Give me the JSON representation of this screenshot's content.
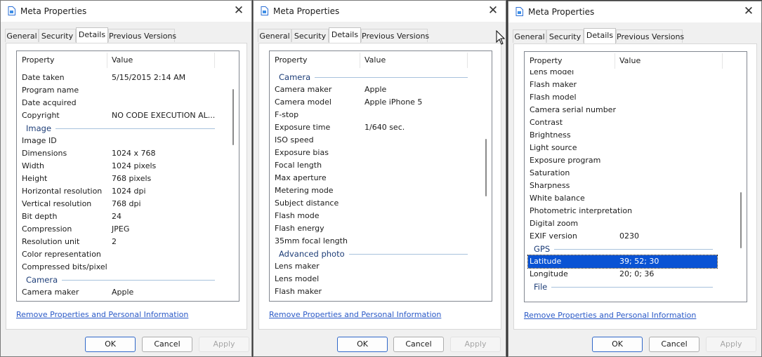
{
  "dialogs": [
    {
      "title": "Meta Properties",
      "tabs": [
        "General",
        "Security",
        "Details",
        "Previous Versions"
      ],
      "active_tab": "Details",
      "columns": {
        "property": "Property",
        "value": "Value"
      },
      "rows": [
        {
          "type": "row",
          "p": "Date taken",
          "v": "5/15/2015 2:14 AM"
        },
        {
          "type": "row",
          "p": "Program name",
          "v": ""
        },
        {
          "type": "row",
          "p": "Date acquired",
          "v": ""
        },
        {
          "type": "row",
          "p": "Copyright",
          "v": "NO CODE EXECUTION AL..."
        },
        {
          "type": "group",
          "p": "Image"
        },
        {
          "type": "row",
          "p": "Image ID",
          "v": ""
        },
        {
          "type": "row",
          "p": "Dimensions",
          "v": "1024 x 768"
        },
        {
          "type": "row",
          "p": "Width",
          "v": "1024 pixels"
        },
        {
          "type": "row",
          "p": "Height",
          "v": "768 pixels"
        },
        {
          "type": "row",
          "p": "Horizontal resolution",
          "v": "1024 dpi"
        },
        {
          "type": "row",
          "p": "Vertical resolution",
          "v": "768 dpi"
        },
        {
          "type": "row",
          "p": "Bit depth",
          "v": "24"
        },
        {
          "type": "row",
          "p": "Compression",
          "v": "JPEG"
        },
        {
          "type": "row",
          "p": "Resolution unit",
          "v": "2"
        },
        {
          "type": "row",
          "p": "Color representation",
          "v": ""
        },
        {
          "type": "row",
          "p": "Compressed bits/pixel",
          "v": ""
        },
        {
          "type": "group",
          "p": "Camera"
        },
        {
          "type": "row",
          "p": "Camera maker",
          "v": "Apple"
        }
      ],
      "remove_link": "Remove Properties and Personal Information",
      "buttons": {
        "ok": "OK",
        "cancel": "Cancel",
        "apply": "Apply"
      }
    },
    {
      "title": "Meta Properties",
      "tabs": [
        "General",
        "Security",
        "Details",
        "Previous Versions"
      ],
      "active_tab": "Details",
      "columns": {
        "property": "Property",
        "value": "Value"
      },
      "rows": [
        {
          "type": "group",
          "p": "Camera"
        },
        {
          "type": "row",
          "p": "Camera maker",
          "v": "Apple"
        },
        {
          "type": "row",
          "p": "Camera model",
          "v": "Apple iPhone 5"
        },
        {
          "type": "row",
          "p": "F-stop",
          "v": ""
        },
        {
          "type": "row",
          "p": "Exposure time",
          "v": "1/640 sec."
        },
        {
          "type": "row",
          "p": "ISO speed",
          "v": ""
        },
        {
          "type": "row",
          "p": "Exposure bias",
          "v": ""
        },
        {
          "type": "row",
          "p": "Focal length",
          "v": ""
        },
        {
          "type": "row",
          "p": "Max aperture",
          "v": ""
        },
        {
          "type": "row",
          "p": "Metering mode",
          "v": ""
        },
        {
          "type": "row",
          "p": "Subject distance",
          "v": ""
        },
        {
          "type": "row",
          "p": "Flash mode",
          "v": ""
        },
        {
          "type": "row",
          "p": "Flash energy",
          "v": ""
        },
        {
          "type": "row",
          "p": "35mm focal length",
          "v": ""
        },
        {
          "type": "group",
          "p": "Advanced photo"
        },
        {
          "type": "row",
          "p": "Lens maker",
          "v": ""
        },
        {
          "type": "row",
          "p": "Lens model",
          "v": ""
        },
        {
          "type": "row",
          "p": "Flash maker",
          "v": ""
        }
      ],
      "remove_link": "Remove Properties and Personal Information",
      "buttons": {
        "ok": "OK",
        "cancel": "Cancel",
        "apply": "Apply"
      }
    },
    {
      "title": "Meta Properties",
      "tabs": [
        "General",
        "Security",
        "Details",
        "Previous Versions"
      ],
      "active_tab": "Details",
      "columns": {
        "property": "Property",
        "value": "Value"
      },
      "rows": [
        {
          "type": "row",
          "p": "Lens model",
          "v": ""
        },
        {
          "type": "row",
          "p": "Flash maker",
          "v": ""
        },
        {
          "type": "row",
          "p": "Flash model",
          "v": ""
        },
        {
          "type": "row",
          "p": "Camera serial number",
          "v": ""
        },
        {
          "type": "row",
          "p": "Contrast",
          "v": ""
        },
        {
          "type": "row",
          "p": "Brightness",
          "v": ""
        },
        {
          "type": "row",
          "p": "Light source",
          "v": ""
        },
        {
          "type": "row",
          "p": "Exposure program",
          "v": ""
        },
        {
          "type": "row",
          "p": "Saturation",
          "v": ""
        },
        {
          "type": "row",
          "p": "Sharpness",
          "v": ""
        },
        {
          "type": "row",
          "p": "White balance",
          "v": ""
        },
        {
          "type": "row",
          "p": "Photometric interpretation",
          "v": ""
        },
        {
          "type": "row",
          "p": "Digital zoom",
          "v": ""
        },
        {
          "type": "row",
          "p": "EXIF version",
          "v": "0230"
        },
        {
          "type": "group",
          "p": "GPS"
        },
        {
          "type": "row",
          "p": "Latitude",
          "v": "39; 52; 30",
          "selected": true
        },
        {
          "type": "row",
          "p": "Longitude",
          "v": "20; 0; 36"
        },
        {
          "type": "group",
          "p": "File"
        }
      ],
      "remove_link": "Remove Properties and Personal Information",
      "buttons": {
        "ok": "OK",
        "cancel": "Cancel",
        "apply": "Apply"
      }
    }
  ],
  "colors": {
    "selection": "#0a53d4",
    "link": "#2a59c7",
    "group": "#1e3e78"
  }
}
